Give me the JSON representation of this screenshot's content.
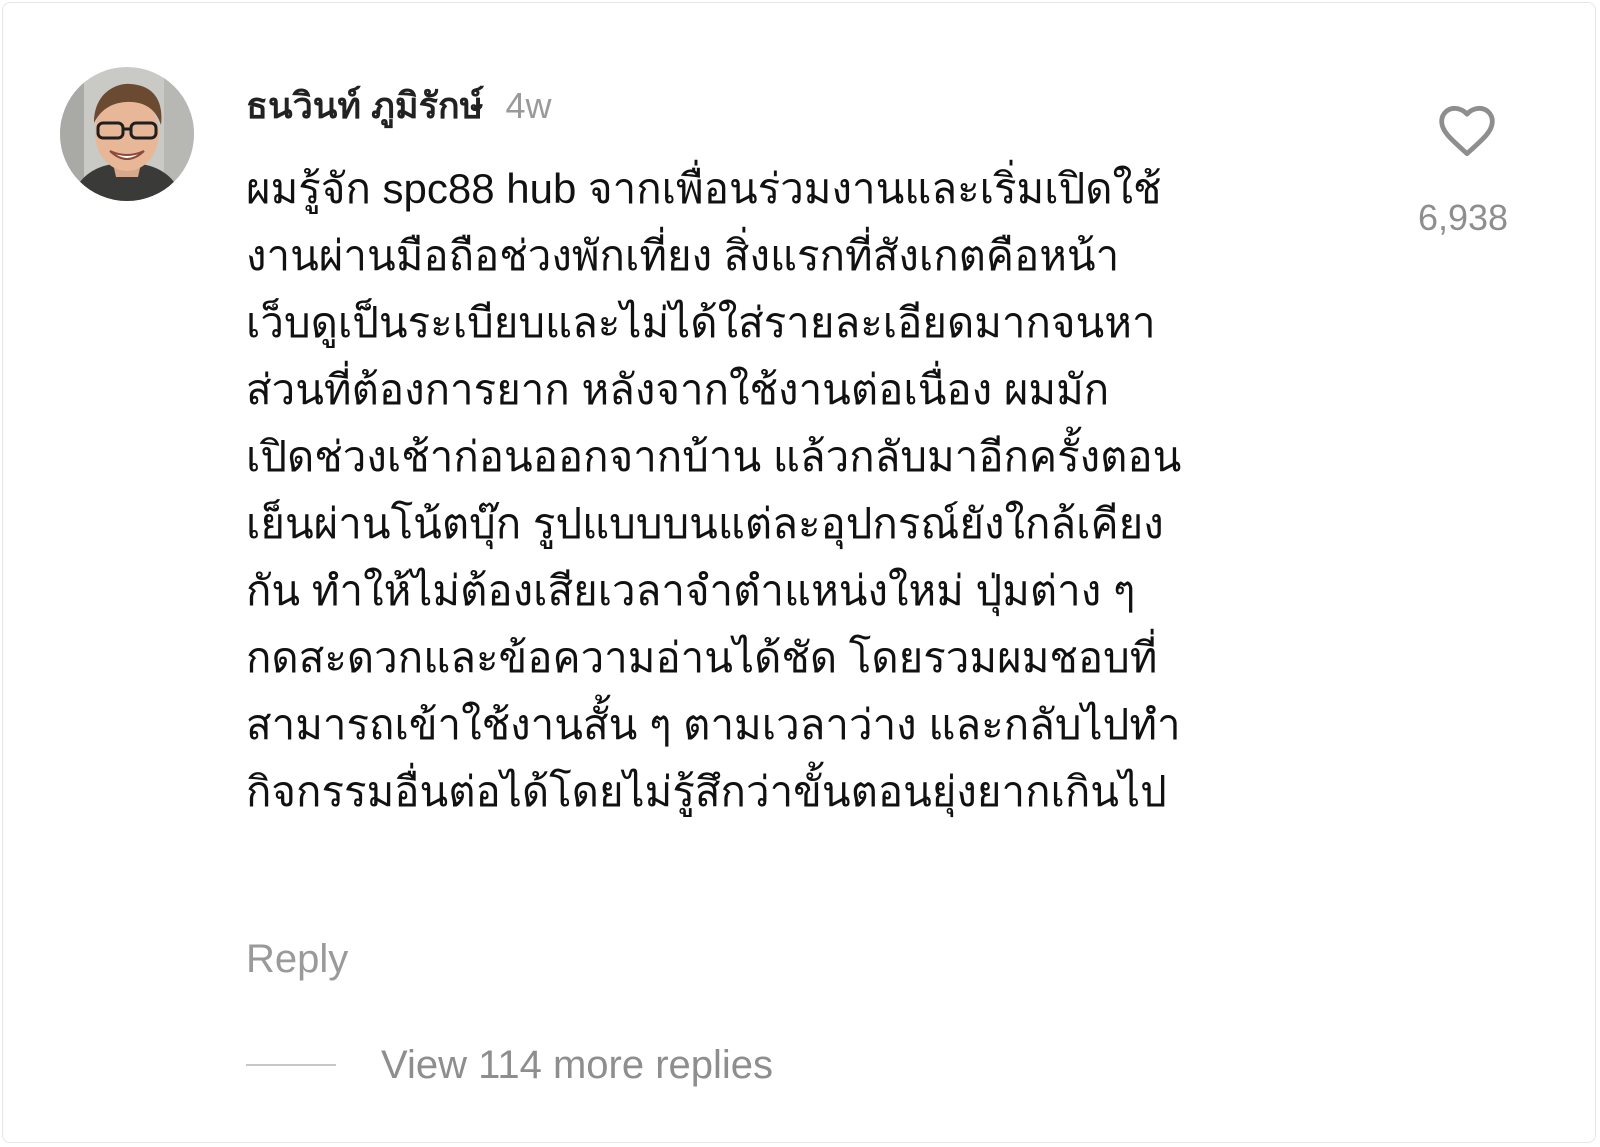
{
  "comment": {
    "username": "ธนวินท์ ภูมิรักษ์",
    "timestamp": "4w",
    "text": "ผมรู้จัก spc88 hub จากเพื่อนร่วมงานและเริ่มเปิดใช้\nงานผ่านมือถือช่วงพักเที่ยง สิ่งแรกที่สังเกตคือหน้า\nเว็บดูเป็นระเบียบและไม่ได้ใส่รายละเอียดมากจนหา\nส่วนที่ต้องการยาก หลังจากใช้งานต่อเนื่อง ผมมัก\nเปิดช่วงเช้าก่อนออกจากบ้าน แล้วกลับมาอีกครั้งตอน\nเย็นผ่านโน้ตบุ๊ก รูปแบบบนแต่ละอุปกรณ์ยังใกล้เคียง\nกัน ทำให้ไม่ต้องเสียเวลาจำตำแหน่งใหม่ ปุ่มต่าง ๆ\nกดสะดวกและข้อความอ่านได้ชัด โดยรวมผมชอบที่\nสามารถเข้าใช้งานสั้น ๆ ตามเวลาว่าง และกลับไปทำ\nกิจกรรมอื่นต่อได้โดยไม่รู้สึกว่าขั้นตอนยุ่งยากเกินไป",
    "like_icon": "heart-outline-icon",
    "like_count": "6,938",
    "reply_label": "Reply",
    "view_replies_label": "View 114 more replies"
  },
  "colors": {
    "text_primary": "#111111",
    "text_secondary": "#8e8e8e",
    "divider": "#c7c7c7",
    "background": "#ffffff"
  }
}
